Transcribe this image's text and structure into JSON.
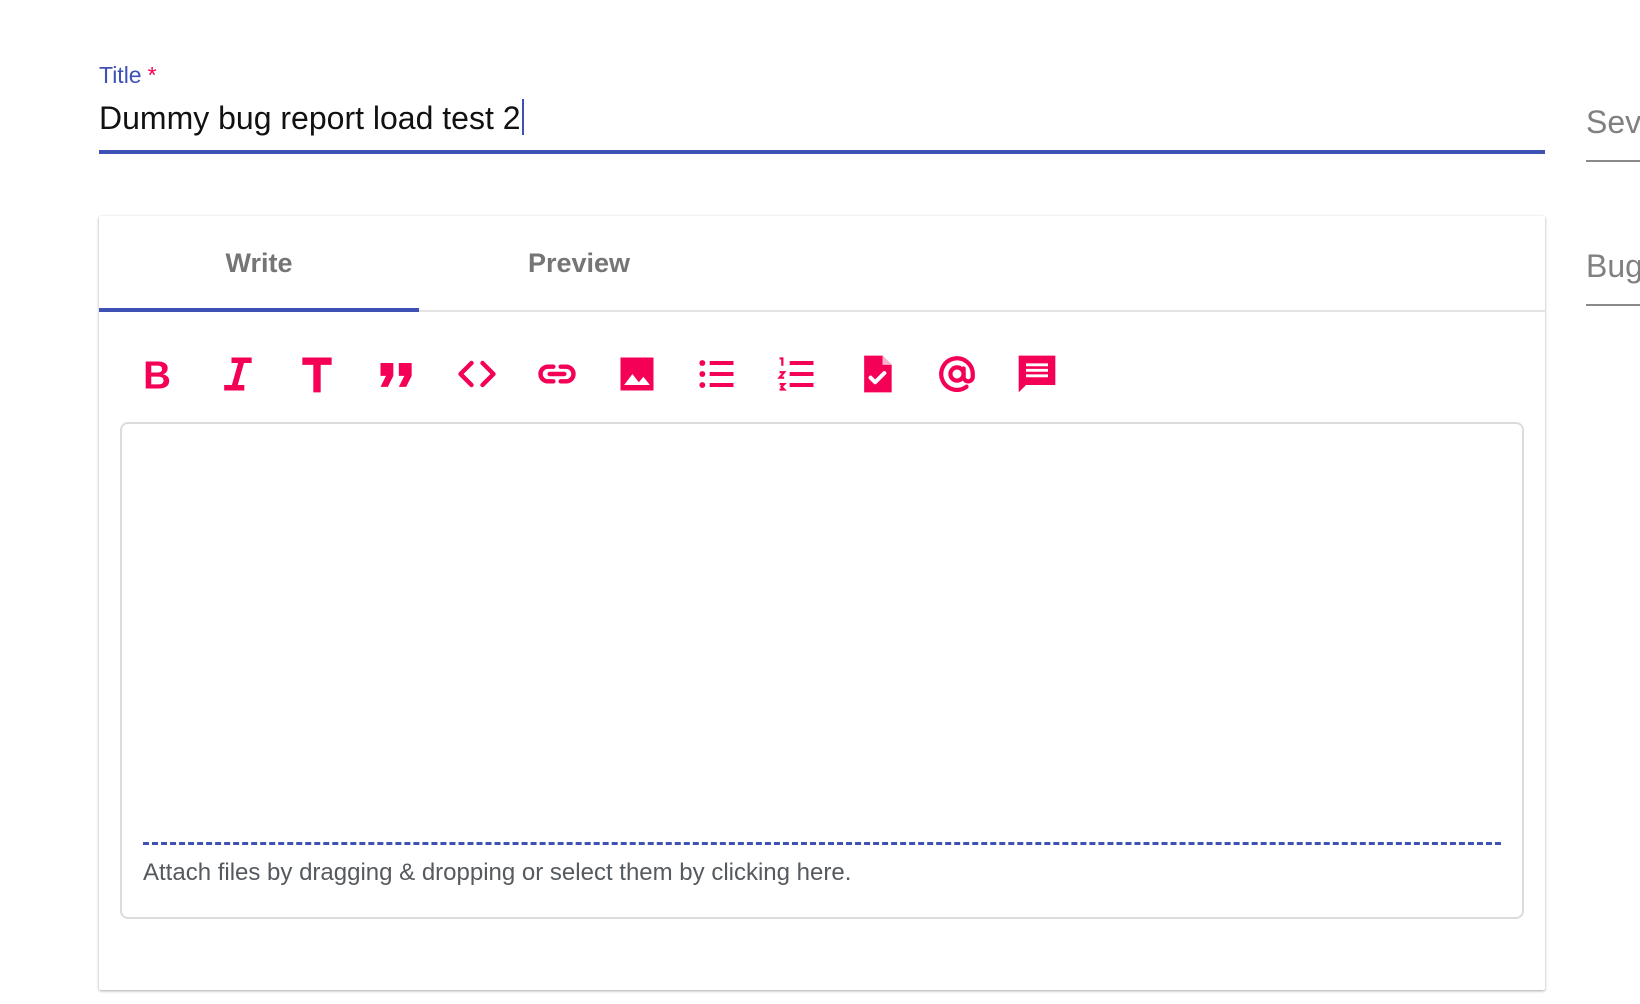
{
  "title_field": {
    "label": "Title",
    "required_mark": "*",
    "value": "Dummy bug report load test 2"
  },
  "side_fields": {
    "severity_label": "Seve",
    "bug_label": "Bug"
  },
  "tabs": [
    {
      "label": "Write",
      "active": true
    },
    {
      "label": "Preview",
      "active": false
    }
  ],
  "toolbar": {
    "icons": [
      "bold-icon",
      "italic-icon",
      "heading-icon",
      "quote-icon",
      "code-icon",
      "link-icon",
      "image-icon",
      "bulleted-list-icon",
      "numbered-list-icon",
      "task-list-icon",
      "mention-icon",
      "saved-reply-icon"
    ]
  },
  "editor": {
    "body": "",
    "attach_hint": "Attach files by dragging & dropping or select them by clicking here."
  },
  "colors": {
    "accent": "#3f51b5",
    "icon": "#f50057",
    "required": "#f50057"
  }
}
